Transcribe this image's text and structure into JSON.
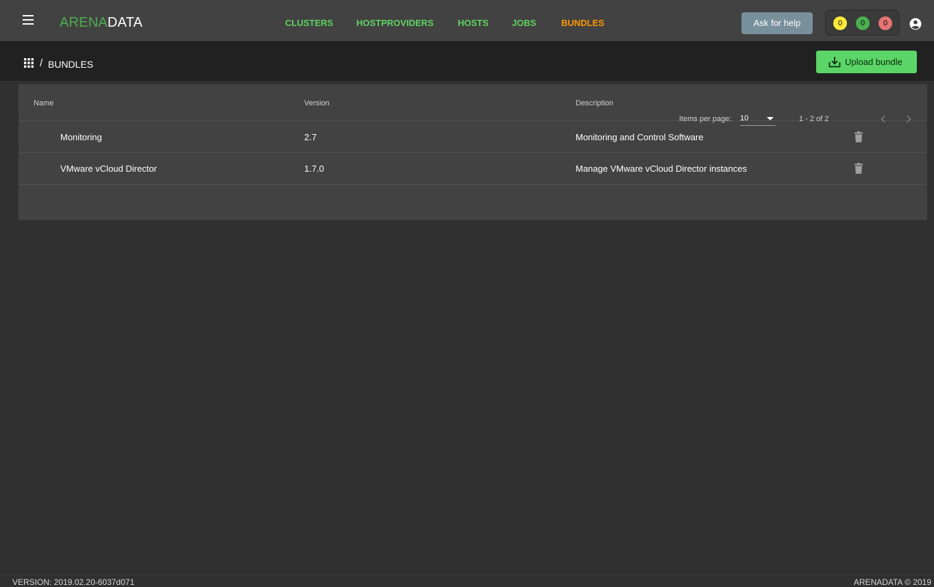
{
  "app": {
    "logo_part1": "ARENA",
    "logo_part2": "DATA"
  },
  "nav": {
    "items": [
      {
        "label": "CLUSTERS",
        "active": false
      },
      {
        "label": "HOSTPROVIDERS",
        "active": false
      },
      {
        "label": "HOSTS",
        "active": false
      },
      {
        "label": "JOBS",
        "active": false
      },
      {
        "label": "BUNDLES",
        "active": true
      }
    ],
    "help_label": "Ask for help",
    "counters": [
      {
        "value": "0",
        "color": "#ffeb3b"
      },
      {
        "value": "0",
        "color": "#4caf50"
      },
      {
        "value": "0",
        "color": "#e57373"
      }
    ],
    "account_icon": "account-circle-icon",
    "menu_icon": "menu-icon"
  },
  "breadcrumb": {
    "home_icon": "apps-icon",
    "separator": "/",
    "current": "BUNDLES"
  },
  "actions": {
    "upload_label": "Upload bundle",
    "upload_icon": "upload-icon"
  },
  "table": {
    "columns": [
      "Name",
      "Version",
      "Description"
    ],
    "rows": [
      {
        "name": "Monitoring",
        "version": "2.7",
        "description": "Monitoring and Control Software",
        "action_icon": "delete-icon"
      },
      {
        "name": "VMware vCloud Director",
        "version": "1.7.0",
        "description": "Manage VMware vCloud Director instances",
        "action_icon": "delete-icon"
      }
    ]
  },
  "paginator": {
    "items_per_page_label": "Items per page:",
    "items_per_page": "10",
    "range_label": "1 - 2 of 2",
    "prev_icon": "chevron-left-icon",
    "next_icon": "chevron-right-icon"
  },
  "footer": {
    "version": "VERSION: 2019.02.20-6037d071",
    "copyright": "ARENADATA © 2019"
  },
  "colors": {
    "nav_link": "#5fd35f",
    "nav_active": "#ff9800",
    "upload_button": "#5bd567",
    "help_button": "#78909c",
    "logo_accent": "#4cae4f"
  }
}
